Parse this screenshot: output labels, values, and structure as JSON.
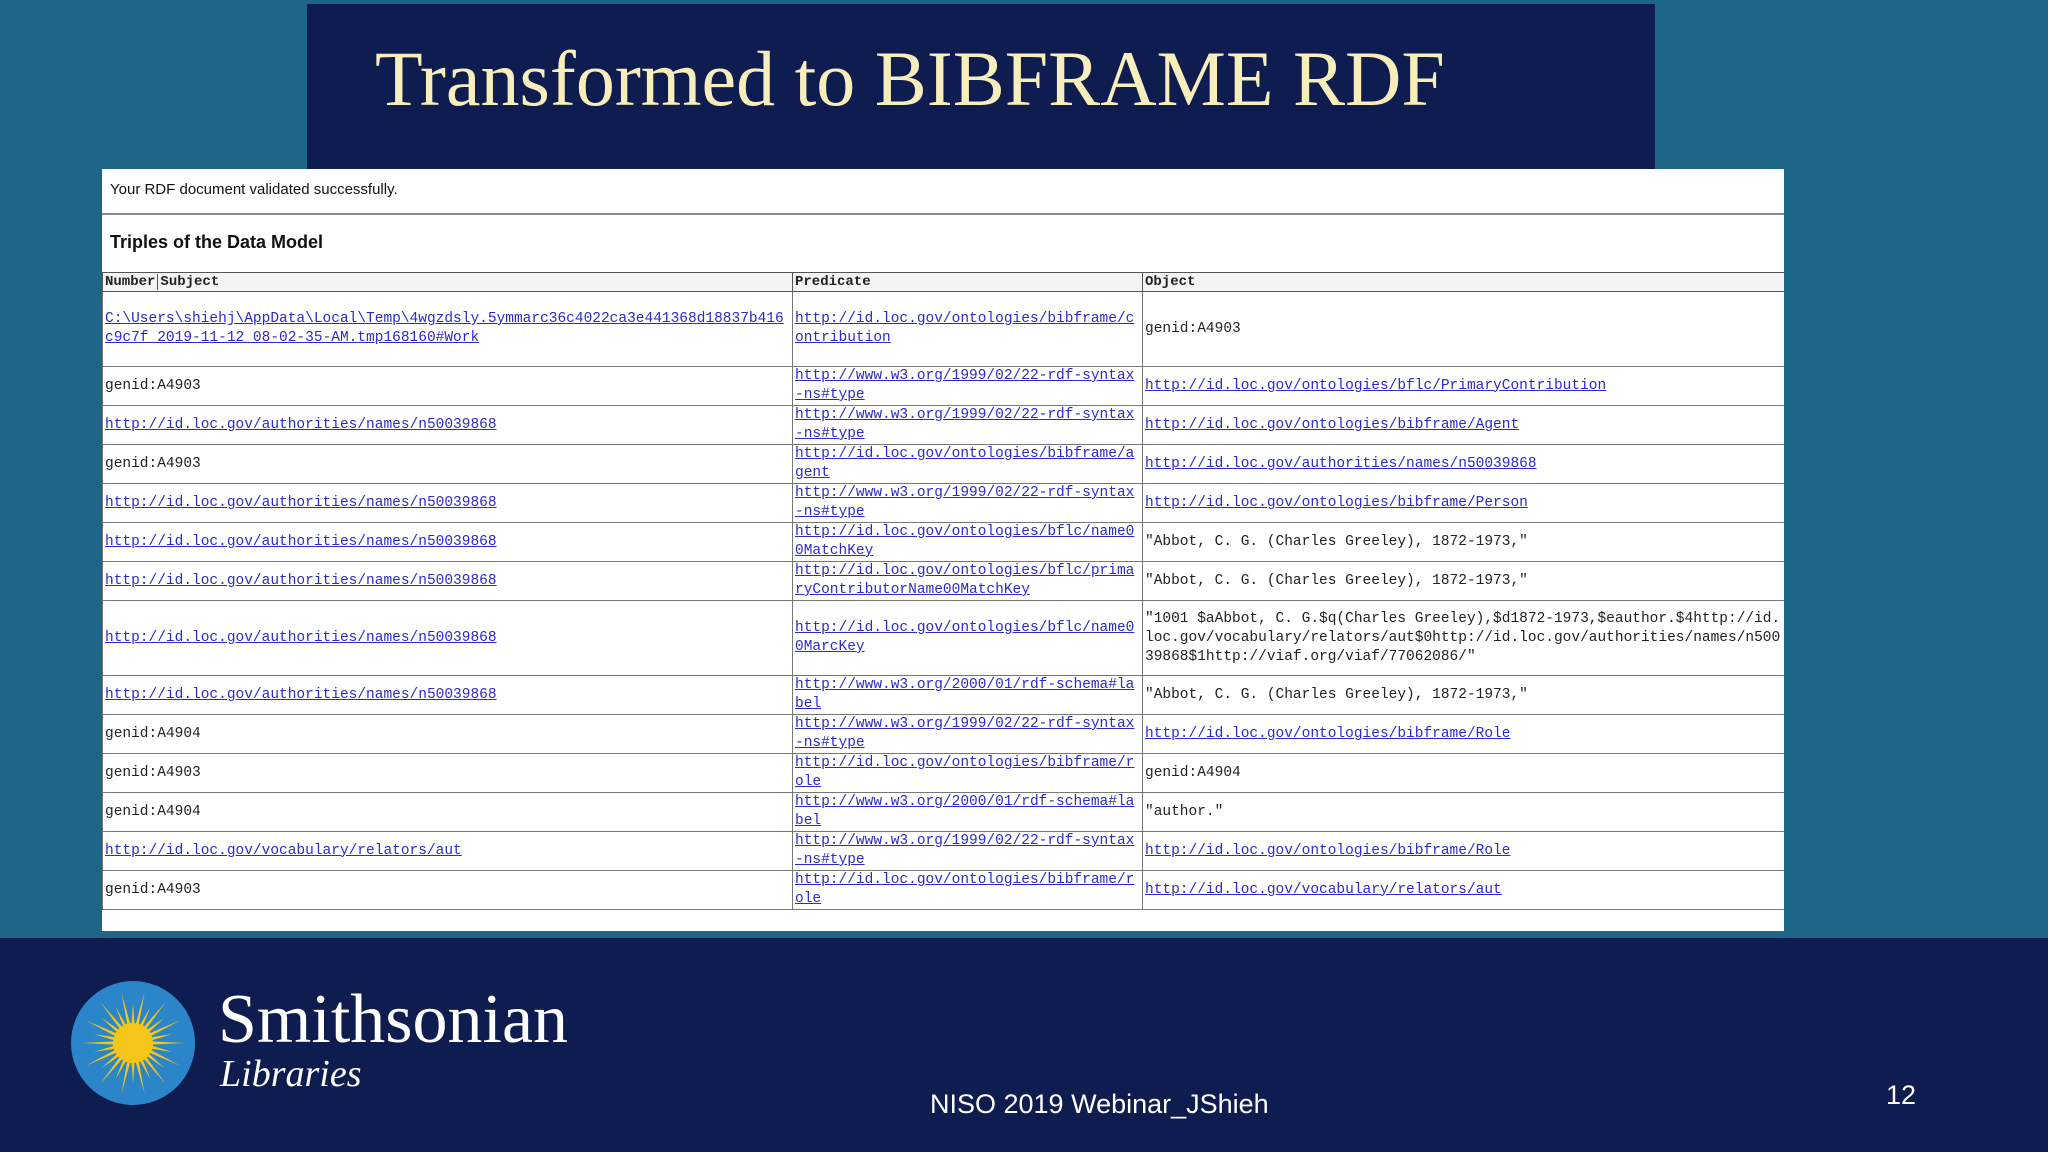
{
  "slide": {
    "title": "Transformed to BIBFRAME RDF",
    "validation_message": "Your RDF document validated successfully.",
    "table_heading": "Triples of the Data Model",
    "columns": [
      "Number",
      "Subject",
      "Predicate",
      "Object"
    ],
    "rows": [
      {
        "subject": "C:\\Users\\shiehj\\AppData\\Local\\Temp\\4wgzdsly.5ymmarc36c4022ca3e441368d18837b416c9c7f_2019-11-12_08-02-35-AM.tmp168160#Work",
        "predicate": "http://id.loc.gov/ontologies/bibframe/contribution",
        "object": "genid:A4903"
      },
      {
        "subject": "genid:A4903",
        "predicate": "http://www.w3.org/1999/02/22-rdf-syntax-ns#type",
        "object": "http://id.loc.gov/ontologies/bflc/PrimaryContribution"
      },
      {
        "subject": "http://id.loc.gov/authorities/names/n50039868",
        "predicate": "http://www.w3.org/1999/02/22-rdf-syntax-ns#type",
        "object": "http://id.loc.gov/ontologies/bibframe/Agent"
      },
      {
        "subject": "genid:A4903",
        "predicate": "http://id.loc.gov/ontologies/bibframe/agent",
        "object": "http://id.loc.gov/authorities/names/n50039868"
      },
      {
        "subject": "http://id.loc.gov/authorities/names/n50039868",
        "predicate": "http://www.w3.org/1999/02/22-rdf-syntax-ns#type",
        "object": "http://id.loc.gov/ontologies/bibframe/Person"
      },
      {
        "subject": "http://id.loc.gov/authorities/names/n50039868",
        "predicate": "http://id.loc.gov/ontologies/bflc/name00MatchKey",
        "object": "\"Abbot, C. G. (Charles Greeley), 1872-1973,\""
      },
      {
        "subject": "http://id.loc.gov/authorities/names/n50039868",
        "predicate": "http://id.loc.gov/ontologies/bflc/primaryContributorName00MatchKey",
        "object": "\"Abbot, C. G. (Charles Greeley), 1872-1973,\""
      },
      {
        "subject": "http://id.loc.gov/authorities/names/n50039868",
        "predicate": "http://id.loc.gov/ontologies/bflc/name00MarcKey",
        "object": "\"1001 $aAbbot, C. G.$q(Charles Greeley),$d1872-1973,$eauthor.$4http://id.loc.gov/vocabulary/relators/aut$0http://id.loc.gov/authorities/names/n50039868$1http://viaf.org/viaf/77062086/\""
      },
      {
        "subject": "http://id.loc.gov/authorities/names/n50039868",
        "predicate": "http://www.w3.org/2000/01/rdf-schema#label",
        "object": "\"Abbot, C. G. (Charles Greeley), 1872-1973,\""
      },
      {
        "subject": "genid:A4904",
        "predicate": "http://www.w3.org/1999/02/22-rdf-syntax-ns#type",
        "object": "http://id.loc.gov/ontologies/bibframe/Role"
      },
      {
        "subject": "genid:A4903",
        "predicate": "http://id.loc.gov/ontologies/bibframe/role",
        "object": "genid:A4904"
      },
      {
        "subject": "genid:A4904",
        "predicate": "http://www.w3.org/2000/01/rdf-schema#label",
        "object": "\"author.\""
      },
      {
        "subject": "http://id.loc.gov/vocabulary/relators/aut",
        "predicate": "http://www.w3.org/1999/02/22-rdf-syntax-ns#type",
        "object": "http://id.loc.gov/ontologies/bibframe/Role"
      },
      {
        "subject": "genid:A4903",
        "predicate": "http://id.loc.gov/ontologies/bibframe/role",
        "object": "http://id.loc.gov/vocabulary/relators/aut"
      }
    ]
  },
  "footer": {
    "brand_name": "Smithsonian",
    "brand_sub": "Libraries",
    "event": "NISO 2019 Webinar_JShieh",
    "page_number": "12"
  },
  "colors": {
    "background": "#1d6688",
    "title_bar": "#0e1c4f",
    "title_text": "#f7eebc",
    "link": "#2b2bcc",
    "sun": "#f5c518",
    "sun_bg": "#2a86c8"
  },
  "icons": [
    "smithsonian-sun-logo-icon"
  ]
}
